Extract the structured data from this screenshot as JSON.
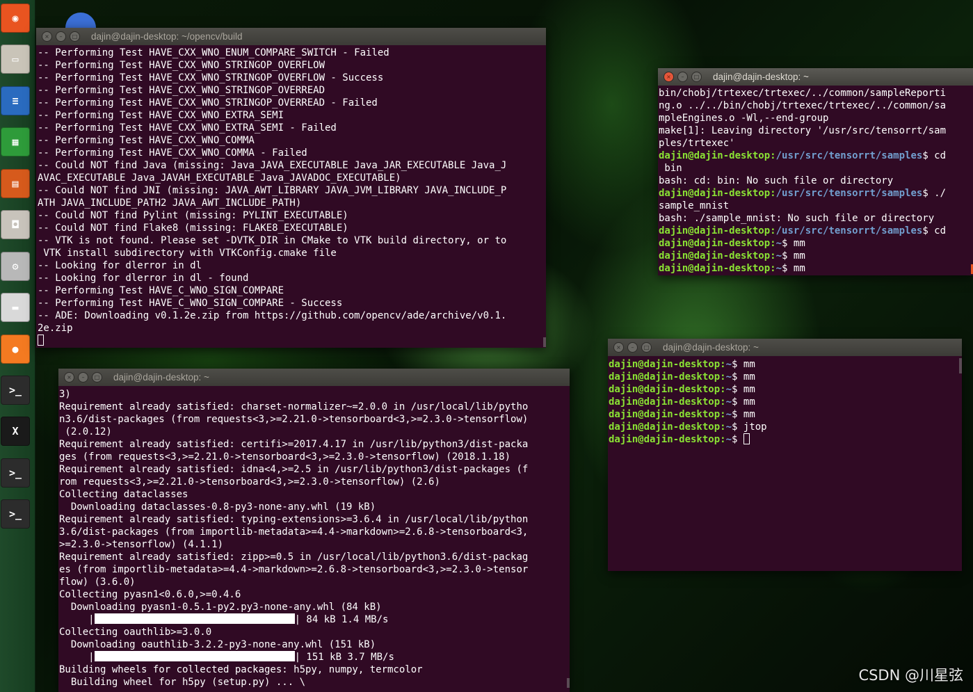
{
  "launcher": {
    "items": [
      {
        "name": "ubuntu-dash-icon",
        "glyph": "◉",
        "color": "#e95420"
      },
      {
        "name": "files-icon",
        "glyph": "▭",
        "color": "#c9c4b8"
      },
      {
        "name": "writer-icon",
        "glyph": "≡",
        "color": "#2a6bbf"
      },
      {
        "name": "calc-icon",
        "glyph": "▦",
        "color": "#2e9b3a"
      },
      {
        "name": "impress-icon",
        "glyph": "▤",
        "color": "#d65a1c"
      },
      {
        "name": "software-center-icon",
        "glyph": "◘",
        "color": "#c8c3bb"
      },
      {
        "name": "settings-icon",
        "glyph": "⚙",
        "color": "#b8b8b8"
      },
      {
        "name": "drive-icon",
        "glyph": "▬",
        "color": "#d9d9d9"
      },
      {
        "name": "firefox-icon",
        "glyph": "●",
        "color": "#f47a21"
      },
      {
        "name": "terminal-icon",
        "glyph": ">_",
        "color": "#2c2c2c"
      },
      {
        "name": "xterm-icon",
        "glyph": "X",
        "color": "#1a1a1a"
      },
      {
        "name": "terminal-icon",
        "glyph": ">_",
        "color": "#2c2c2c"
      },
      {
        "name": "terminal-icon",
        "glyph": ">_",
        "color": "#2c2c2c"
      }
    ]
  },
  "windows": {
    "opencv": {
      "title": "dajin@dajin-desktop: ~/opencv/build",
      "lines": [
        "-- Performing Test HAVE_CXX_WNO_ENUM_COMPARE_SWITCH - Failed",
        "-- Performing Test HAVE_CXX_WNO_STRINGOP_OVERFLOW",
        "-- Performing Test HAVE_CXX_WNO_STRINGOP_OVERFLOW - Success",
        "-- Performing Test HAVE_CXX_WNO_STRINGOP_OVERREAD",
        "-- Performing Test HAVE_CXX_WNO_STRINGOP_OVERREAD - Failed",
        "-- Performing Test HAVE_CXX_WNO_EXTRA_SEMI",
        "-- Performing Test HAVE_CXX_WNO_EXTRA_SEMI - Failed",
        "-- Performing Test HAVE_CXX_WNO_COMMA",
        "-- Performing Test HAVE_CXX_WNO_COMMA - Failed",
        "-- Could NOT find Java (missing: Java_JAVA_EXECUTABLE Java_JAR_EXECUTABLE Java_J",
        "AVAC_EXECUTABLE Java_JAVAH_EXECUTABLE Java_JAVADOC_EXECUTABLE)",
        "-- Could NOT find JNI (missing: JAVA_AWT_LIBRARY JAVA_JVM_LIBRARY JAVA_INCLUDE_P",
        "ATH JAVA_INCLUDE_PATH2 JAVA_AWT_INCLUDE_PATH)",
        "-- Could NOT find Pylint (missing: PYLINT_EXECUTABLE)",
        "-- Could NOT find Flake8 (missing: FLAKE8_EXECUTABLE)",
        "-- VTK is not found. Please set -DVTK_DIR in CMake to VTK build directory, or to",
        " VTK install subdirectory with VTKConfig.cmake file",
        "-- Looking for dlerror in dl",
        "-- Looking for dlerror in dl - found",
        "-- Performing Test HAVE_C_WNO_SIGN_COMPARE",
        "-- Performing Test HAVE_C_WNO_SIGN_COMPARE - Success",
        "-- ADE: Downloading v0.1.2e.zip from https://github.com/opencv/ade/archive/v0.1.",
        "2e.zip"
      ]
    },
    "tensorrt": {
      "title": "dajin@dajin-desktop: ~",
      "lines": [
        {
          "text": "bin/chobj/trtexec/trtexec/../common/sampleReporti"
        },
        {
          "text": "ng.o ../../bin/chobj/trtexec/trtexec/../common/sa"
        },
        {
          "text": "mpleEngines.o -Wl,--end-group"
        },
        {
          "text": "make[1]: Leaving directory '/usr/src/tensorrt/sam"
        },
        {
          "text": "ples/trtexec'"
        },
        {
          "user": "dajin@dajin-desktop",
          "path": "/usr/src/tensorrt/samples",
          "cmd": "$ cd"
        },
        {
          "text": " bin"
        },
        {
          "text": "bash: cd: bin: No such file or directory"
        },
        {
          "user": "dajin@dajin-desktop",
          "path": "/usr/src/tensorrt/samples",
          "cmd": "$ ./"
        },
        {
          "text": "sample_mnist"
        },
        {
          "text": "bash: ./sample_mnist: No such file or directory"
        },
        {
          "user": "dajin@dajin-desktop",
          "path": "/usr/src/tensorrt/samples",
          "cmd": "$ cd"
        },
        {
          "user": "dajin@dajin-desktop",
          "path": "~",
          "cmd": "$ mm"
        },
        {
          "user": "dajin@dajin-desktop",
          "path": "~",
          "cmd": "$ mm"
        },
        {
          "user": "dajin@dajin-desktop",
          "path": "~",
          "cmd": "$ mm"
        }
      ]
    },
    "jtop": {
      "title": "dajin@dajin-desktop: ~",
      "lines": [
        {
          "user": "dajin@dajin-desktop",
          "path": "~",
          "cmd": "$ mm"
        },
        {
          "user": "dajin@dajin-desktop",
          "path": "~",
          "cmd": "$ mm"
        },
        {
          "user": "dajin@dajin-desktop",
          "path": "~",
          "cmd": "$ mm"
        },
        {
          "user": "dajin@dajin-desktop",
          "path": "~",
          "cmd": "$ mm"
        },
        {
          "user": "dajin@dajin-desktop",
          "path": "~",
          "cmd": "$ mm"
        },
        {
          "user": "dajin@dajin-desktop",
          "path": "~",
          "cmd": "$ jtop"
        },
        {
          "user": "dajin@dajin-desktop",
          "path": "~",
          "cmd": "$ ",
          "cursor": true
        }
      ]
    },
    "pip": {
      "title": "dajin@dajin-desktop: ~",
      "lines": [
        {
          "text": "3)"
        },
        {
          "text": "Requirement already satisfied: charset-normalizer~=2.0.0 in /usr/local/lib/pytho"
        },
        {
          "text": "n3.6/dist-packages (from requests<3,>=2.21.0->tensorboard<3,>=2.3.0->tensorflow)"
        },
        {
          "text": " (2.0.12)"
        },
        {
          "text": "Requirement already satisfied: certifi>=2017.4.17 in /usr/lib/python3/dist-packa"
        },
        {
          "text": "ges (from requests<3,>=2.21.0->tensorboard<3,>=2.3.0->tensorflow) (2018.1.18)"
        },
        {
          "text": "Requirement already satisfied: idna<4,>=2.5 in /usr/lib/python3/dist-packages (f"
        },
        {
          "text": "rom requests<3,>=2.21.0->tensorboard<3,>=2.3.0->tensorflow) (2.6)"
        },
        {
          "text": "Collecting dataclasses"
        },
        {
          "text": "  Downloading dataclasses-0.8-py3-none-any.whl (19 kB)"
        },
        {
          "text": "Requirement already satisfied: typing-extensions>=3.6.4 in /usr/local/lib/python"
        },
        {
          "text": "3.6/dist-packages (from importlib-metadata>=4.4->markdown>=2.6.8->tensorboard<3,"
        },
        {
          "text": ">=2.3.0->tensorflow) (4.1.1)"
        },
        {
          "text": "Requirement already satisfied: zipp>=0.5 in /usr/local/lib/python3.6/dist-packag"
        },
        {
          "text": "es (from importlib-metadata>=4.4->markdown>=2.6.8->tensorboard<3,>=2.3.0->tensor"
        },
        {
          "text": "flow) (3.6.0)"
        },
        {
          "text": "Collecting pyasn1<0.6.0,>=0.4.6"
        },
        {
          "text": "  Downloading pyasn1-0.5.1-py2.py3-none-any.whl (84 kB)"
        },
        {
          "bar": true,
          "pre": "     |",
          "post": "| 84 kB 1.4 MB/s",
          "progress": 1.0
        },
        {
          "text": "Collecting oauthlib>=3.0.0"
        },
        {
          "text": "  Downloading oauthlib-3.2.2-py3-none-any.whl (151 kB)"
        },
        {
          "bar": true,
          "pre": "     |",
          "post": "| 151 kB 3.7 MB/s",
          "progress": 1.0
        },
        {
          "text": "Building wheels for collected packages: h5py, numpy, termcolor"
        },
        {
          "text": "  Building wheel for h5py (setup.py) ... \\"
        }
      ]
    }
  },
  "watermark": "CSDN @川星弦"
}
